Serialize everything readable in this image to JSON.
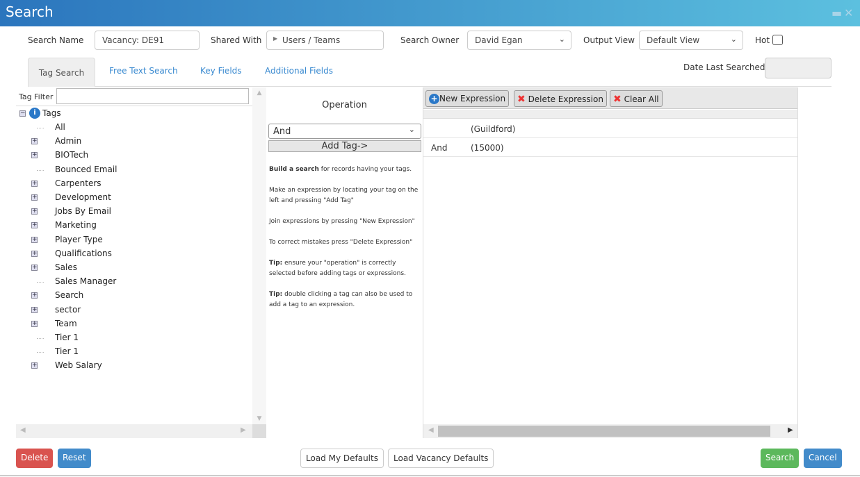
{
  "window": {
    "title": "Search",
    "minimize": "▬",
    "close": "✕"
  },
  "form": {
    "search_name_label": "Search Name",
    "search_name_value": "Vacancy: DE91",
    "shared_with_label": "Shared With",
    "shared_with_value": "Users / Teams",
    "search_owner_label": "Search Owner",
    "search_owner_value": "David Egan",
    "output_view_label": "Output View",
    "output_view_value": "Default View",
    "hot_label": "Hot",
    "hot_checked": false,
    "date_last_searched_label": "Date Last Searched",
    "date_last_searched_value": ""
  },
  "tabs": [
    {
      "label": "Tag Search",
      "active": true
    },
    {
      "label": "Free Text Search"
    },
    {
      "label": "Key Fields"
    },
    {
      "label": "Additional Fields"
    }
  ],
  "tag_filter": {
    "label": "Tag Filter",
    "value": ""
  },
  "tree": {
    "root": "Tags",
    "items": [
      {
        "label": "All",
        "expandable": false
      },
      {
        "label": "Admin",
        "expandable": true
      },
      {
        "label": "BIOTech",
        "expandable": true
      },
      {
        "label": "Bounced Email",
        "expandable": false
      },
      {
        "label": "Carpenters",
        "expandable": true
      },
      {
        "label": "Development",
        "expandable": true
      },
      {
        "label": "Jobs By Email",
        "expandable": true
      },
      {
        "label": "Marketing",
        "expandable": true
      },
      {
        "label": "Player Type",
        "expandable": true
      },
      {
        "label": "Qualifications",
        "expandable": true
      },
      {
        "label": "Sales",
        "expandable": true
      },
      {
        "label": "Sales Manager",
        "expandable": false
      },
      {
        "label": "Search",
        "expandable": true
      },
      {
        "label": "sector",
        "expandable": true
      },
      {
        "label": "Team",
        "expandable": true
      },
      {
        "label": "Tier 1",
        "expandable": false
      },
      {
        "label": "Tier 1",
        "expandable": false
      },
      {
        "label": "Web Salary",
        "expandable": true
      }
    ]
  },
  "operation": {
    "title": "Operation",
    "value": "And",
    "add_tag": "Add Tag->",
    "help": [
      {
        "bold": "Build a search",
        "text": " for records having your tags."
      },
      {
        "bold": "",
        "text": "Make an expression by locating your tag on the left and pressing \"Add Tag\""
      },
      {
        "bold": "",
        "text": "Join expressions by pressing \"New Expression\""
      },
      {
        "bold": "",
        "text": "To correct mistakes press \"Delete Expression\""
      },
      {
        "bold": "Tip:",
        "text": " ensure your \"operation\" is correctly selected before adding tags or expressions."
      },
      {
        "bold": "Tip:",
        "text": " double clicking a tag can also be used to add a tag to an expression."
      }
    ]
  },
  "expressions": {
    "new": "New Expression",
    "delete": "Delete Expression",
    "clear": "Clear All",
    "rows": [
      {
        "op": "",
        "value": "(Guildford)"
      },
      {
        "op": "And",
        "value": "(15000)"
      }
    ]
  },
  "footer": {
    "delete": "Delete",
    "reset": "Reset",
    "load_my": "Load My Defaults",
    "load_vacancy": "Load Vacancy Defaults",
    "search": "Search",
    "cancel": "Cancel"
  },
  "colors": {
    "danger": "#d9534f",
    "primary": "#428bca",
    "success": "#5cb85c",
    "link": "#3a8ad0"
  }
}
